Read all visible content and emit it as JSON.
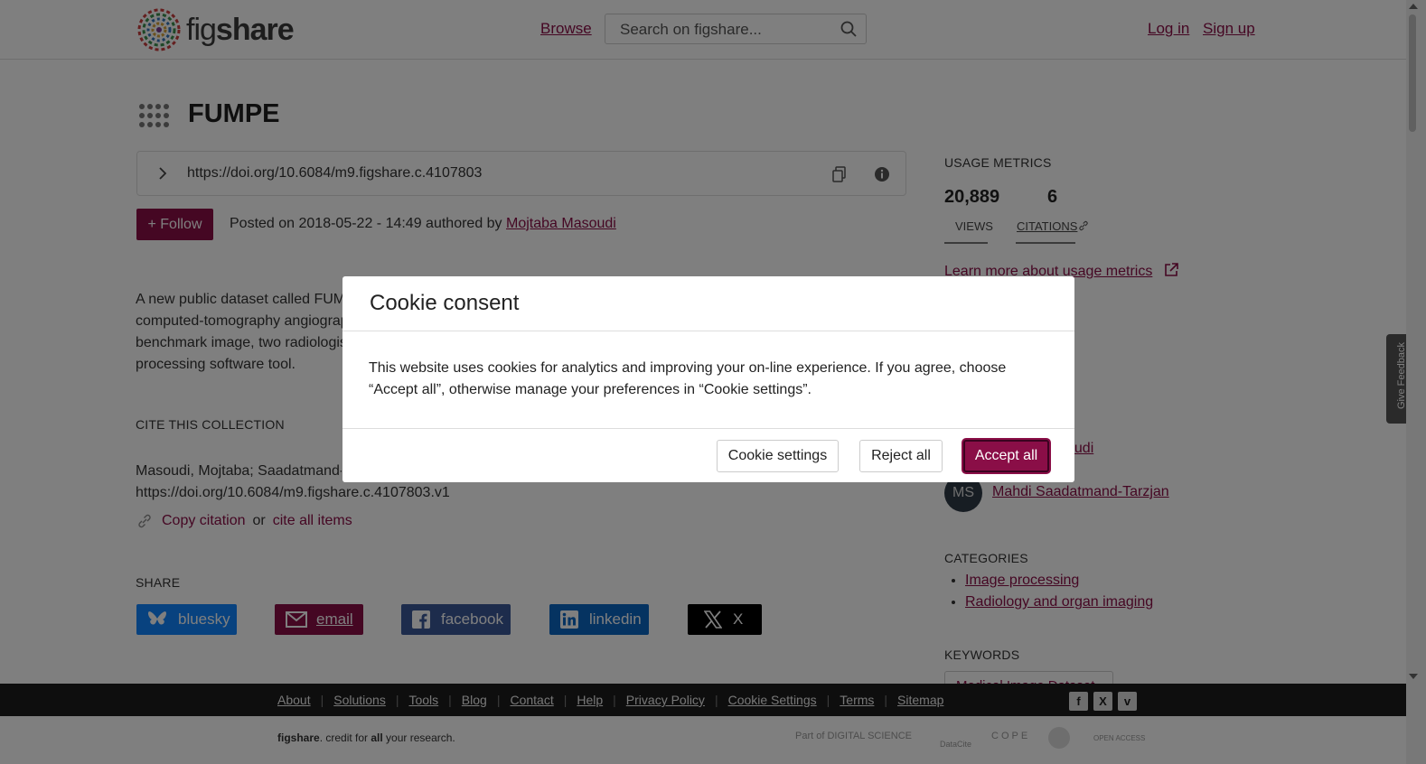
{
  "header": {
    "logo_text_light": "fig",
    "logo_text_bold": "share",
    "browse": "Browse",
    "search_placeholder": "Search on figshare...",
    "login": "Log in",
    "signup": "Sign up"
  },
  "item": {
    "title": "FUMPE",
    "doi_url": "https://doi.org/10.6084/m9.figshare.c.4107803",
    "follow_label": "+ Follow",
    "posted_prefix": "Posted on 2018-05-22 - 14:49 authored by",
    "posted_author": "Mojtaba Masoudi",
    "description_lines": [
      "A new public dataset called FUM",
      "computed-tomography angiograp",
      "benchmark image, two radiologis",
      "processing software tool."
    ]
  },
  "cite": {
    "heading": "CITE THIS COLLECTION",
    "line1": "Masoudi, Mojtaba; Saadatmand-",
    "line2": "https://doi.org/10.6084/m9.figshare.c.4107803.v1",
    "copy_citation": "Copy citation",
    "or": "or",
    "cite_all": "cite all items"
  },
  "share": {
    "heading": "SHARE",
    "buttons": [
      "bluesky",
      "email",
      "facebook",
      "linkedin",
      "X"
    ]
  },
  "metrics": {
    "heading": "USAGE METRICS",
    "views_value": "20,889",
    "views_label": "VIEWS",
    "citations_value": "6",
    "citations_label": "CITATIONS",
    "learn_more": "Learn more about usage metrics"
  },
  "authors": {
    "partial_author": "oudi",
    "avatar_initials": "MS",
    "second_author": "Mahdi Saadatmand-Tarzjan"
  },
  "categories": {
    "heading": "CATEGORIES",
    "items": [
      "Image processing",
      "Radiology and organ imaging"
    ]
  },
  "keywords": {
    "heading": "KEYWORDS",
    "first": "Medical Image Dataset"
  },
  "feedback": "Give Feedback",
  "footer": {
    "links": [
      "About",
      "Solutions",
      "Tools",
      "Blog",
      "Contact",
      "Help",
      "Privacy Policy",
      "Cookie Settings",
      "Terms",
      "Sitemap"
    ],
    "social": [
      "f",
      "X",
      "v"
    ],
    "tagline_brand": "figshare",
    "tagline_rest1": ". credit for ",
    "tagline_all": "all",
    "tagline_rest2": " your research.",
    "partners": [
      "Part of DIGITAL SCIENCE",
      "DataCite",
      "COPE",
      "",
      "OPEN ACCESS"
    ]
  },
  "cookie_modal": {
    "title": "Cookie consent",
    "body": "This website uses cookies for analytics and improving your on-line experience. If you agree, choose “Accept all”, otherwise manage your preferences in “Cookie settings”.",
    "settings": "Cookie settings",
    "reject": "Reject all",
    "accept": "Accept all"
  },
  "colors": {
    "brand": "#8a0e47",
    "bluesky": "#1185fe",
    "facebook": "#3b5998",
    "linkedin": "#0a66c2",
    "x": "#000000"
  }
}
